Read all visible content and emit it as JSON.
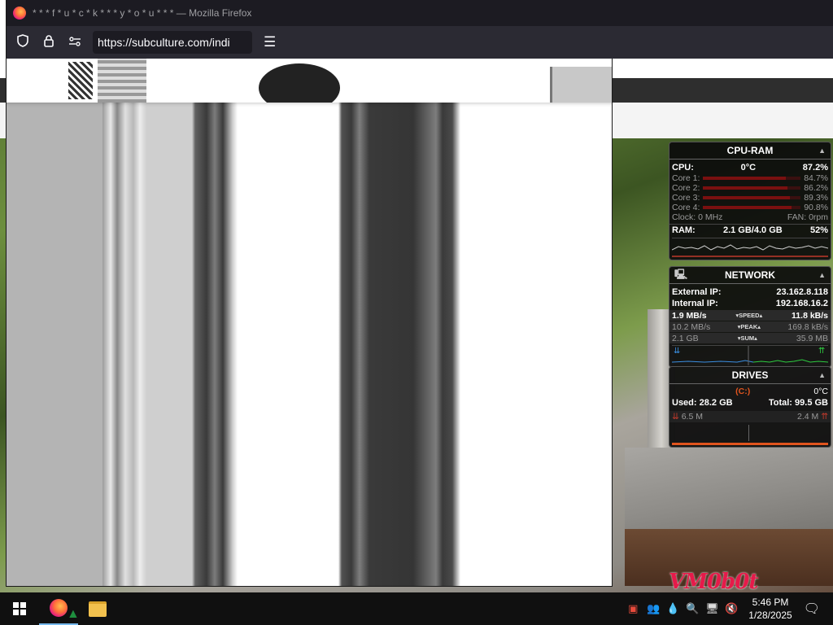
{
  "window": {
    "title": "* * * f * u * c * k * * * y * o * u * * * — Mozilla Firefox"
  },
  "toolbar": {
    "url": "https://subculture.com/indi"
  },
  "gadgets": {
    "cpu_ram": {
      "title": "CPU-RAM",
      "cpu_label": "CPU:",
      "cpu_temp": "0°C",
      "cpu_percent": "87.2%",
      "cores": [
        {
          "label": "Core 1:",
          "value": "84.7%",
          "fraction": 0.847
        },
        {
          "label": "Core 2:",
          "value": "86.2%",
          "fraction": 0.862
        },
        {
          "label": "Core 3:",
          "value": "89.3%",
          "fraction": 0.893
        },
        {
          "label": "Core 4:",
          "value": "90.8%",
          "fraction": 0.908
        }
      ],
      "clock": "Clock: 0 MHz",
      "fan": "FAN: 0rpm",
      "ram_label": "RAM:",
      "ram_usage": "2.1 GB/4.0 GB",
      "ram_percent": "52%"
    },
    "network": {
      "title": "NETWORK",
      "external_ip_label": "External IP:",
      "external_ip": "23.162.8.118",
      "internal_ip_label": "Internal IP:",
      "internal_ip": "192.168.16.2",
      "speed_down": "1.9 MB/s",
      "speed_label": "▾SPEED▴",
      "speed_up": "11.8 kB/s",
      "peak_down": "10.2 MB/s",
      "peak_label": "▾PEAK▴",
      "peak_up": "169.8 kB/s",
      "sum_down": "2.1 GB",
      "sum_label": "▾SUM▴",
      "sum_up": "35.9 MB"
    },
    "drives": {
      "title": "DRIVES",
      "drive_letter": "(C:)",
      "temp": "0°C",
      "used": "Used: 28.2 GB",
      "total": "Total: 99.5 GB",
      "read": "6.5 M",
      "write": "2.4 M"
    }
  },
  "watermark": "VM0b0t",
  "taskbar": {
    "time": "5:46 PM",
    "date": "1/28/2025"
  },
  "colors": {
    "firefox_titlebar": "#1c1b22",
    "firefox_toolbar": "#2b2a33",
    "taskbar": "#101010",
    "gadget_accent": "#e0541e"
  }
}
